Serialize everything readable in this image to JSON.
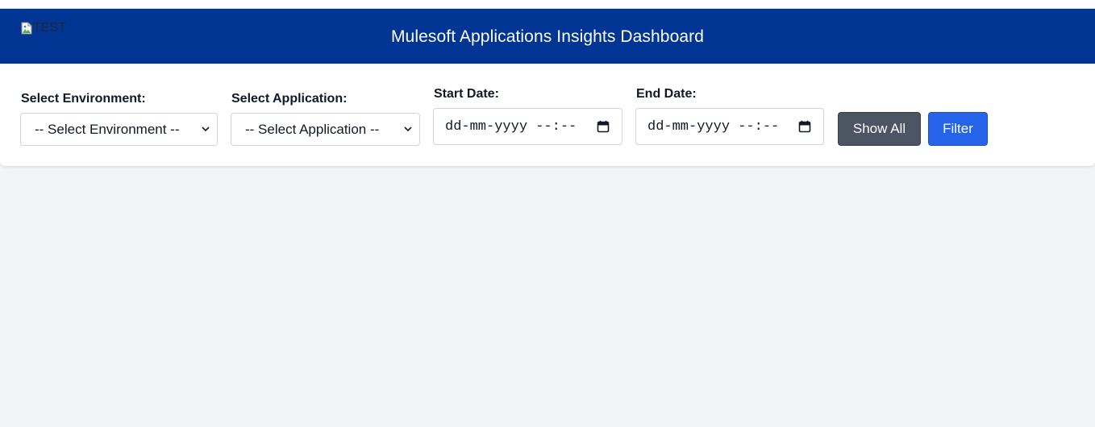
{
  "header": {
    "logo_alt": "TEST",
    "title": "Mulesoft Applications Insights Dashboard",
    "background": "#003594"
  },
  "filters": {
    "environment": {
      "label": "Select Environment:",
      "selected": "-- Select Environment --"
    },
    "application": {
      "label": "Select Application:",
      "selected": "-- Select Application --"
    },
    "start_date": {
      "label": "Start Date:",
      "value": "dd-mm-yyyy --:--"
    },
    "end_date": {
      "label": "End Date:",
      "value": "dd-mm-yyyy --:--"
    },
    "show_all_label": "Show All",
    "filter_label": "Filter"
  },
  "icons": {
    "logo": "broken-image-icon",
    "select_chevron": "chevron-down-icon",
    "date_picker": "calendar-icon"
  },
  "colors": {
    "show_all_button": "#4b5563",
    "filter_button": "#2563eb",
    "page_background": "#f3f4f6"
  }
}
